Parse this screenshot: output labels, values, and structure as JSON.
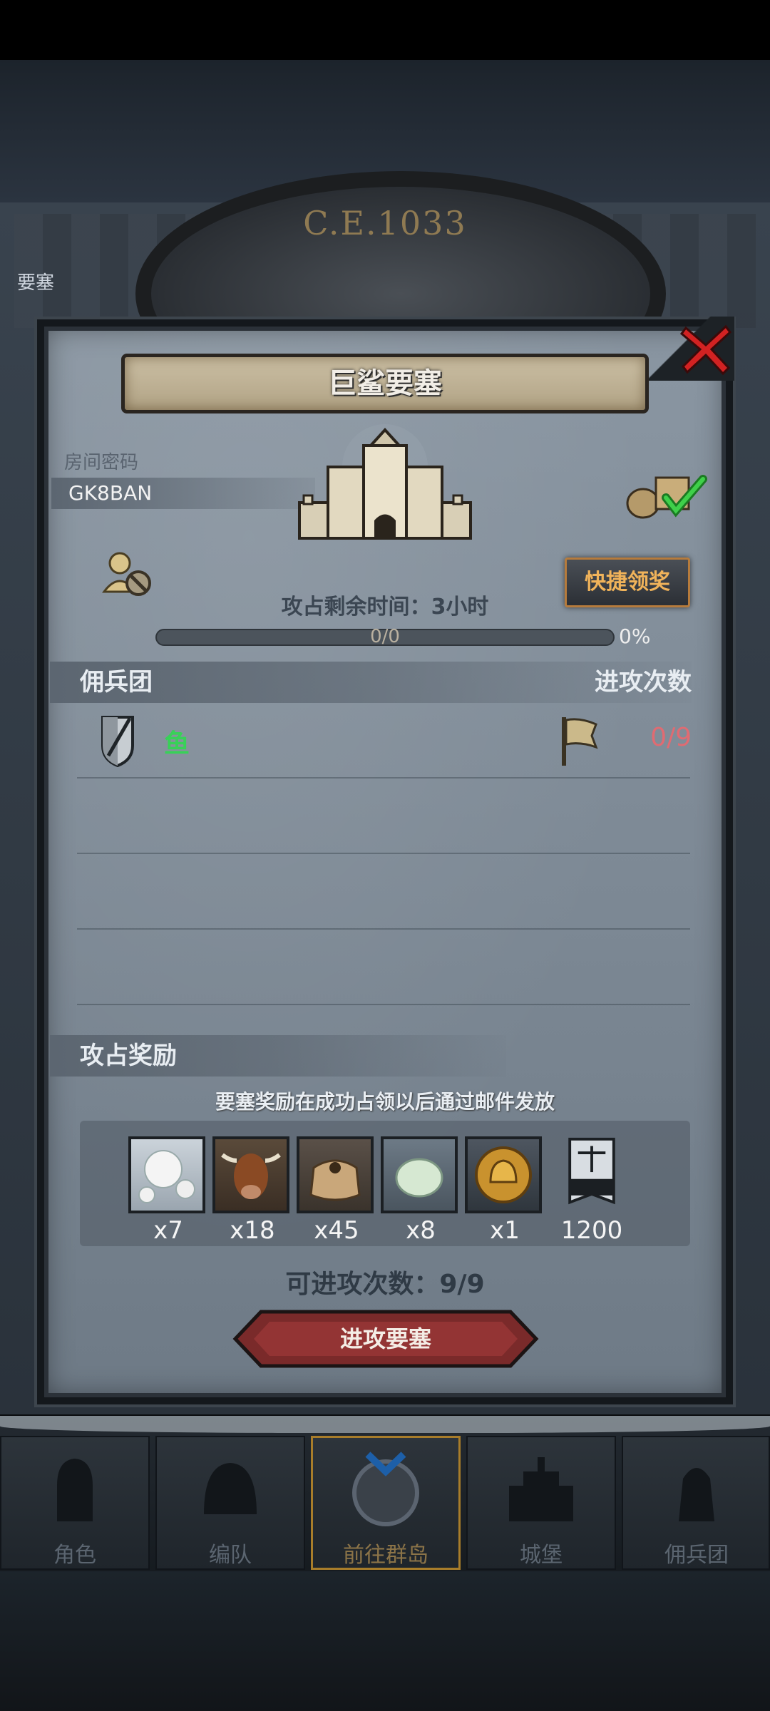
{
  "scene": {
    "era": "C.E.1033",
    "side_text": "要塞"
  },
  "dialog": {
    "title": "巨鲨要塞",
    "room_label": "房间密码",
    "room_code": "GK8BAN",
    "quick_claim": "快捷领奖",
    "remaining_time_label": "攻占剩余时间：",
    "remaining_time": "3小时",
    "progress_text": "0/0",
    "progress_percent": "0%",
    "progress_fraction": 0
  },
  "mercenary": {
    "section_label": "佣兵团",
    "attack_count_label": "进攻次数",
    "rows": [
      {
        "name": "鱼",
        "count": "0/9"
      }
    ]
  },
  "rewards": {
    "section_label": "攻占奖励",
    "note": "要塞奖励在成功占领以后通过邮件发放",
    "items": [
      {
        "icon": "pearl-icon",
        "qty": "x7"
      },
      {
        "icon": "ox-icon",
        "qty": "x18"
      },
      {
        "icon": "grain-sack-icon",
        "qty": "x45"
      },
      {
        "icon": "jade-stone-icon",
        "qty": "x8"
      },
      {
        "icon": "gold-helmet-coin-icon",
        "qty": "x1"
      },
      {
        "icon": "justice-banner-icon",
        "qty": "1200"
      }
    ]
  },
  "attempts": "可进攻次数：9/9",
  "attack_button": "进攻要塞",
  "nav": [
    {
      "label": "角色",
      "icon": "knight-icon"
    },
    {
      "label": "编队",
      "icon": "helmet-icon"
    },
    {
      "label": "前往群岛",
      "icon": "globe-icon",
      "active": true
    },
    {
      "label": "城堡",
      "icon": "castle-icon"
    },
    {
      "label": "佣兵团",
      "icon": "soldier-icon"
    }
  ],
  "colors": {
    "accent_gold": "#b67b3c",
    "merc_name": "#38d158",
    "count_red": "#e06b72",
    "button_red": "#7a2a2a"
  }
}
